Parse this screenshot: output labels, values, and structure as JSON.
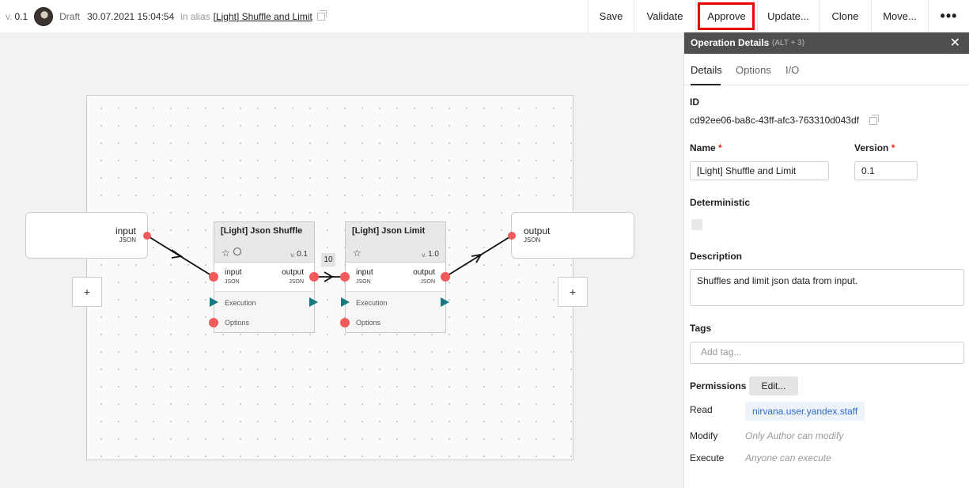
{
  "header": {
    "version_prefix": "v.",
    "version": "0.1",
    "status": "Draft",
    "date": "30.07.2021 15:04:54",
    "alias_prefix": "in alias",
    "alias_name": "[Light] Shuffle and Limit",
    "actions": [
      "Save",
      "Validate",
      "Approve",
      "Update...",
      "Clone",
      "Move...",
      "•••"
    ],
    "highlighted_action": "Approve",
    "highlight_color": "#e00000"
  },
  "canvas": {
    "input_block": {
      "name": "input",
      "type": "JSON"
    },
    "output_block": {
      "name": "output",
      "type": "JSON"
    },
    "plus_label": "+",
    "edge_badge": "10",
    "operations": [
      {
        "title": "[Light] Json Shuffle",
        "version_prefix": "v.",
        "version": "0.1",
        "input_label": "input",
        "input_type": "JSON",
        "output_label": "output",
        "output_type": "JSON",
        "execution_label": "Execution",
        "options_label": "Options",
        "icons": [
          "star-icon",
          "history-icon"
        ]
      },
      {
        "title": "[Light] Json Limit",
        "version_prefix": "v.",
        "version": "1.0",
        "input_label": "input",
        "input_type": "JSON",
        "output_label": "output",
        "output_type": "JSON",
        "execution_label": "Execution",
        "options_label": "Options",
        "icons": [
          "star-icon"
        ]
      }
    ],
    "port_color": "#f05a5a",
    "exec_color": "#127a82"
  },
  "panel": {
    "title": "Operation Details",
    "hotkey": "(ALT + 3)",
    "close_label": "✕",
    "tabs": [
      "Details",
      "Options",
      "I/O"
    ],
    "active_tab": "Details",
    "id_label": "ID",
    "id_value": "cd92ee06-ba8c-43ff-afc3-763310d043df",
    "name_label": "Name",
    "name_value": "[Light] Shuffle and Limit",
    "version_label": "Version",
    "version_value": "0.1",
    "required_mark": "*",
    "deterministic_label": "Deterministic",
    "description_label": "Description",
    "description_value": "Shuffles and limit json data from input.",
    "tags_label": "Tags",
    "tags_placeholder": "Add tag...",
    "permissions_label": "Permissions",
    "edit_label": "Edit...",
    "read_label": "Read",
    "read_value": "nirvana.user.yandex.staff",
    "modify_label": "Modify",
    "modify_value": "Only Author can modify",
    "execute_label": "Execute",
    "execute_value": "Anyone can execute"
  }
}
